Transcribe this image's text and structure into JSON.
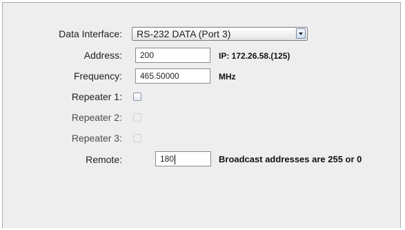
{
  "form": {
    "data_interface": {
      "label": "Data Interface:",
      "value": "RS-232 DATA (Port 3)"
    },
    "address": {
      "label": "Address:",
      "value": "200",
      "ip_note": "IP: 172.26.58.(125)"
    },
    "frequency": {
      "label": "Frequency:",
      "value": "465.50000",
      "unit": "MHz"
    },
    "repeater_1": {
      "label": "Repeater 1:",
      "checked": false,
      "enabled": true
    },
    "repeater_2": {
      "label": "Repeater 2:",
      "checked": false,
      "enabled": false
    },
    "repeater_3": {
      "label": "Repeater 3:",
      "checked": false,
      "enabled": false
    },
    "remote": {
      "label": "Remote:",
      "value": "180",
      "note": "Broadcast addresses are 255 or 0"
    }
  },
  "colors": {
    "panel_background": "#eeeeee",
    "panel_border": "#a9a9a9",
    "text": "#1e1e1e"
  }
}
